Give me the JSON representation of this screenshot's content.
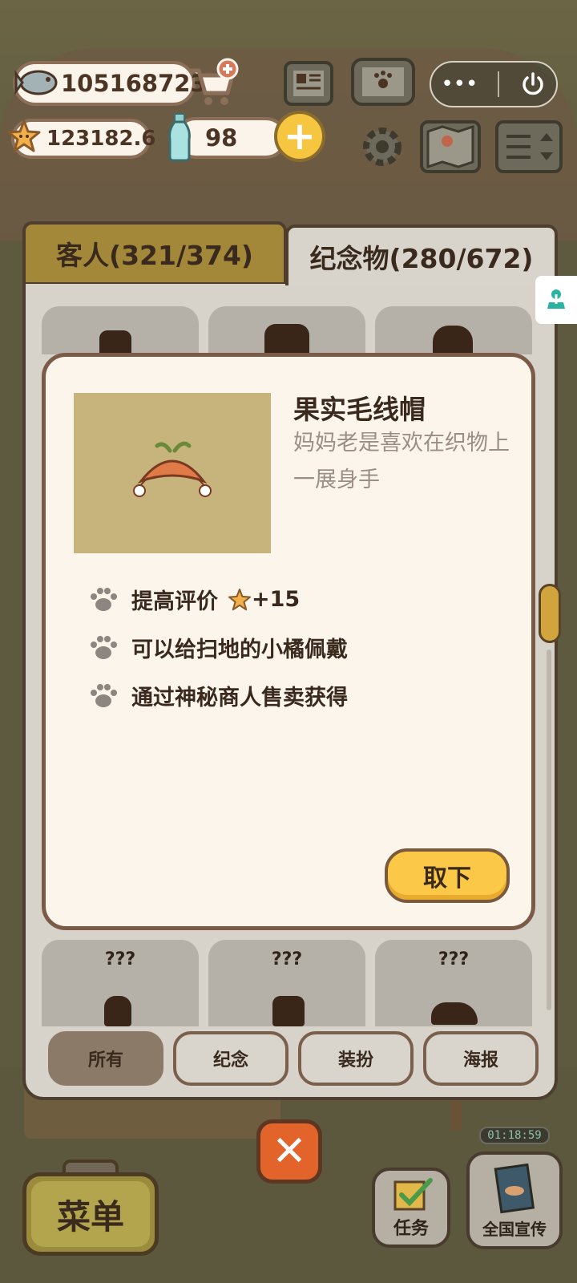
{
  "hud": {
    "fish_count": "105168723",
    "star_count": "123182.6",
    "bottle_count": "98",
    "plus_label": "+",
    "capsule_more": "•••"
  },
  "tabs": {
    "guests": "客人(321/374)",
    "souvenirs": "纪念物(280/672)"
  },
  "grid": {
    "unknown_label": "???"
  },
  "popup": {
    "name": "果实毛线帽",
    "description": "妈妈老是喜欢在织物上一展身手",
    "features": [
      {
        "text": "提高评价",
        "bonus": "+15"
      },
      {
        "text": "可以给扫地的小橘佩戴"
      },
      {
        "text": "通过神秘商人售卖获得"
      }
    ],
    "remove_button": "取下"
  },
  "filters": [
    "所有",
    "纪念",
    "装扮",
    "海报"
  ],
  "active_filter": "所有",
  "bottom": {
    "close_symbol": "✕",
    "menu": "菜单",
    "tasks": "任务",
    "promotion": "全国宣传",
    "timer": "01:18:59"
  },
  "colors": {
    "accent_yellow": "#fbc947",
    "panel_border": "#4e3e2f",
    "popup_bg": "#fcf5ec",
    "close_orange": "#e3642b"
  }
}
